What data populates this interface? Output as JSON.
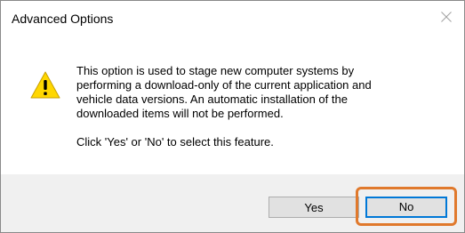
{
  "dialog": {
    "title": "Advanced Options",
    "icon": "warning-icon",
    "message": "This option is used to stage new computer systems by\nperforming a download-only of the current application and\nvehicle data versions.  An automatic installation of the\ndownloaded items will not be performed.",
    "prompt": "Click 'Yes' or 'No' to select this feature."
  },
  "buttons": {
    "yes_label": "Yes",
    "no_label": "No"
  },
  "colors": {
    "highlight": "#e0792c",
    "focus": "#0078d7",
    "warning_fill": "#ffd700"
  }
}
